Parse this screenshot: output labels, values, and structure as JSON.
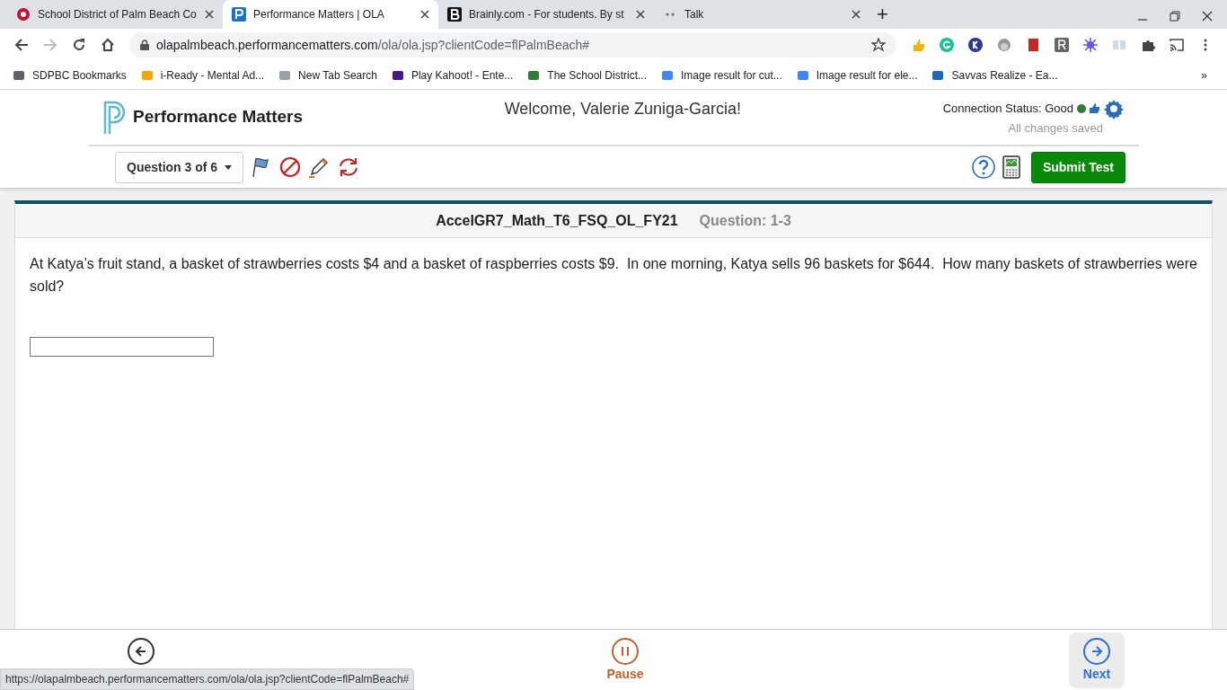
{
  "browser": {
    "tabs": [
      {
        "title": "School District of Palm Beach Co",
        "kind": "circle",
        "selected": false
      },
      {
        "title": "Performance Matters | OLA",
        "kind": "p",
        "selected": true
      },
      {
        "title": "Brainly.com - For students. By st",
        "kind": "b",
        "selected": false
      },
      {
        "title": "Talk",
        "kind": "dots",
        "selected": false
      }
    ],
    "new_tab": "+",
    "address": {
      "host": "olapalmbeach.performancematters.com",
      "path": "/ola/ola.jsp?clientCode=flPalmBeach#"
    },
    "bookmarks": [
      {
        "title": "SDPBC Bookmarks",
        "color": "#5f6368"
      },
      {
        "title": "i-Ready - Mental Ad...",
        "color": "#f4a300"
      },
      {
        "title": "New Tab Search",
        "color": "#9aa0a6"
      },
      {
        "title": "Play Kahoot! - Ente...",
        "color": "#46178f"
      },
      {
        "title": "The School District...",
        "color": "#2e7d32"
      },
      {
        "title": "Image result for cut...",
        "color": "#4285f4"
      },
      {
        "title": "Image result for ele...",
        "color": "#4285f4"
      },
      {
        "title": "Savvas Realize - Ea...",
        "color": "#1e6bb8"
      }
    ],
    "more_bookmarks": "»",
    "status_url": "https://olapalmbeach.performancematters.com/ola/ola.jsp?clientCode=flPalmBeach#"
  },
  "app": {
    "brand": "Performance Matters",
    "welcome": "Welcome, Valerie Zuniga-Garcia!",
    "connection": "Connection Status: Good",
    "saved": "All changes saved",
    "question_menu": "Question 3 of 6",
    "submit": "Submit Test"
  },
  "question": {
    "test_name": "AccelGR7_Math_T6_FSQ_OL_FY21",
    "number": "Question: 1-3",
    "text": "At Katya’s fruit stand, a basket of strawberries costs $4 and a basket of raspberries costs $9.  In one morning, Katya sells 96 baskets for $644.  How many baskets of strawberries were sold?"
  },
  "footer": [
    {
      "kind": "previous",
      "selected": false
    },
    {
      "kind": "pause",
      "label": "Pause",
      "selected": false
    },
    {
      "kind": "next",
      "label": "Next",
      "selected": true
    }
  ]
}
